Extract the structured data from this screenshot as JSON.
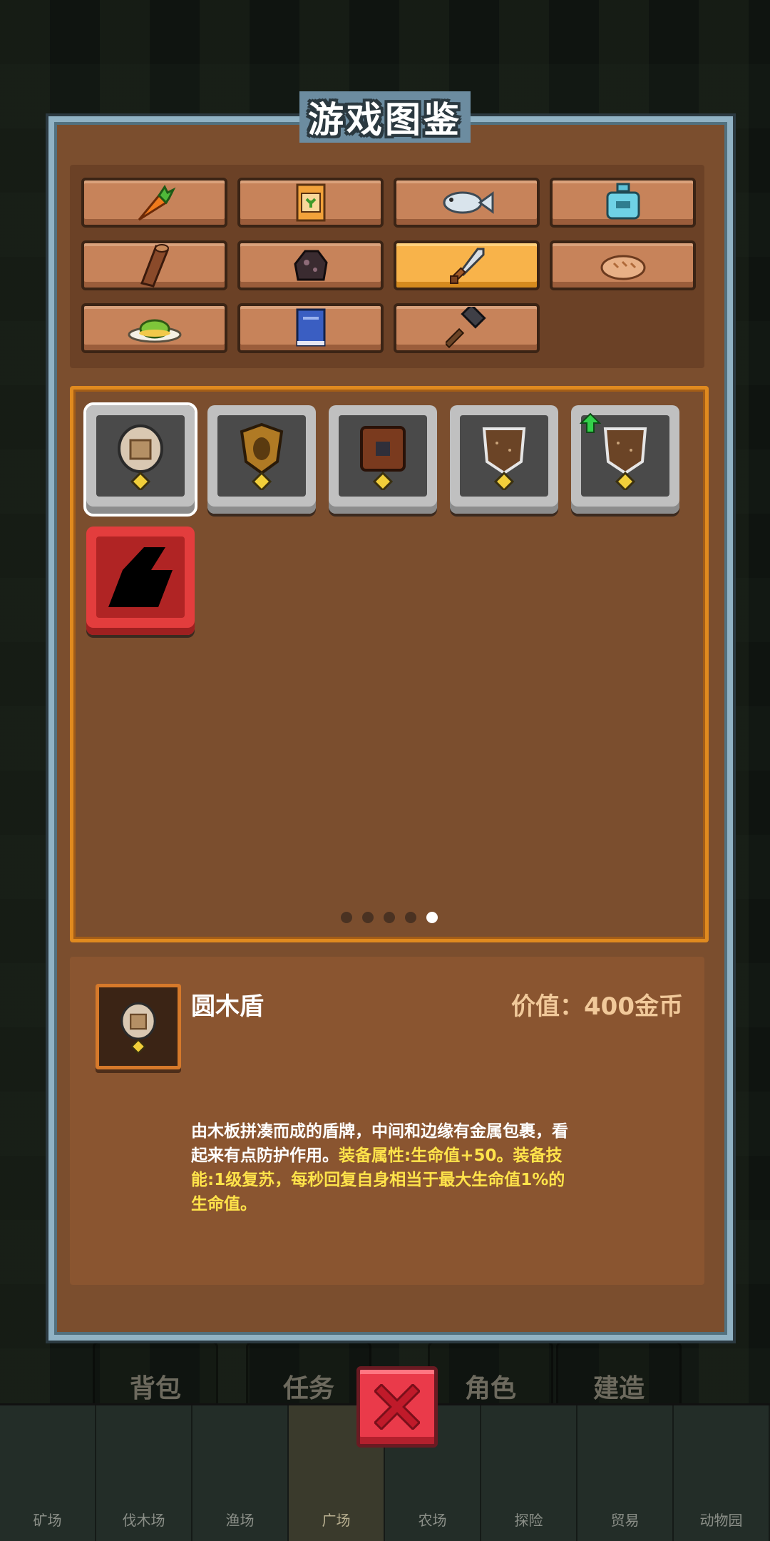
{
  "dialog": {
    "title": "游戏图鉴"
  },
  "categories": [
    {
      "name": "carrot-icon",
      "active": false
    },
    {
      "name": "seed-pack-icon",
      "active": false
    },
    {
      "name": "fish-icon",
      "active": false
    },
    {
      "name": "potion-icon",
      "active": false
    },
    {
      "name": "log-icon",
      "active": false
    },
    {
      "name": "ore-icon",
      "active": false
    },
    {
      "name": "sword-icon",
      "active": true
    },
    {
      "name": "bread-icon",
      "active": false
    },
    {
      "name": "dish-icon",
      "active": false
    },
    {
      "name": "book-icon",
      "active": false
    },
    {
      "name": "hammer-icon",
      "active": false
    }
  ],
  "items": [
    {
      "name": "round-wood-shield",
      "selected": true
    },
    {
      "name": "bronze-shield",
      "selected": false
    },
    {
      "name": "leather-shield",
      "selected": false
    },
    {
      "name": "wooden-shield",
      "selected": false
    },
    {
      "name": "upgraded-wooden-shield",
      "selected": false
    },
    {
      "name": "locked-item",
      "locked": true
    }
  ],
  "pager": {
    "count": 5,
    "current": 5
  },
  "detail": {
    "name": "圆木盾",
    "value": "价值：400金币",
    "desc_plain": "由木板拼凑而成的盾牌，中间和边缘有金属包裹，看起来有点防护作用。",
    "desc_highlight": "装备属性:生命值+50。装备技能:1级复苏，每秒回复自身相当于最大生命值1%的生命值。"
  },
  "background": {
    "hud_labels": [
      "背包",
      "任务",
      "角色",
      "建造"
    ],
    "bottom_tabs": [
      "矿场",
      "伐木场",
      "渔场",
      "广场",
      "农场",
      "探险",
      "贸易",
      "动物园"
    ]
  },
  "colors": {
    "panel": "#7b4e2e",
    "accent_orange": "#e08a1f",
    "active_tab": "#f8b34a",
    "highlight_text": "#ffe34a",
    "close_red": "#ea3a4a"
  }
}
